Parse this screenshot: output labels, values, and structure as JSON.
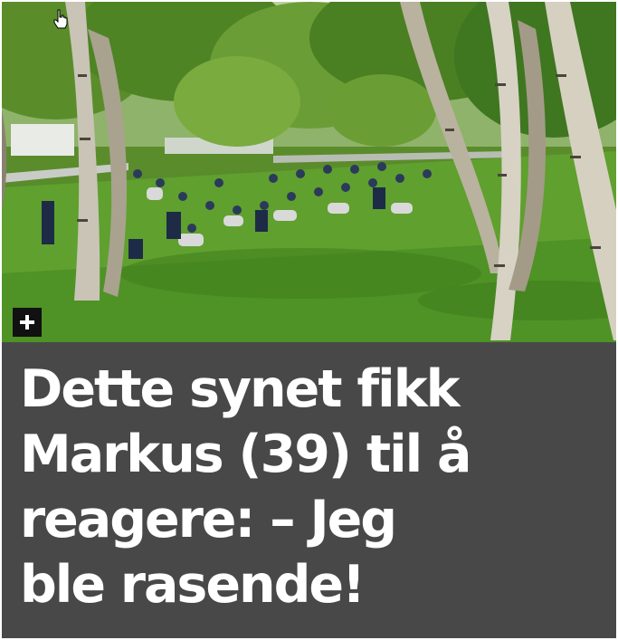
{
  "article": {
    "headline": "Dette synet fikk\nMarkus (39) til å\nreagere: – Jeg\nble rasende!"
  },
  "photo": {
    "expand_icon": "plus-icon",
    "cursor_icon": "hand-pointer-icon"
  },
  "colors": {
    "headline_panel_bg": "#484848",
    "headline_text": "#ffffff",
    "expand_button_bg": "#111111"
  }
}
